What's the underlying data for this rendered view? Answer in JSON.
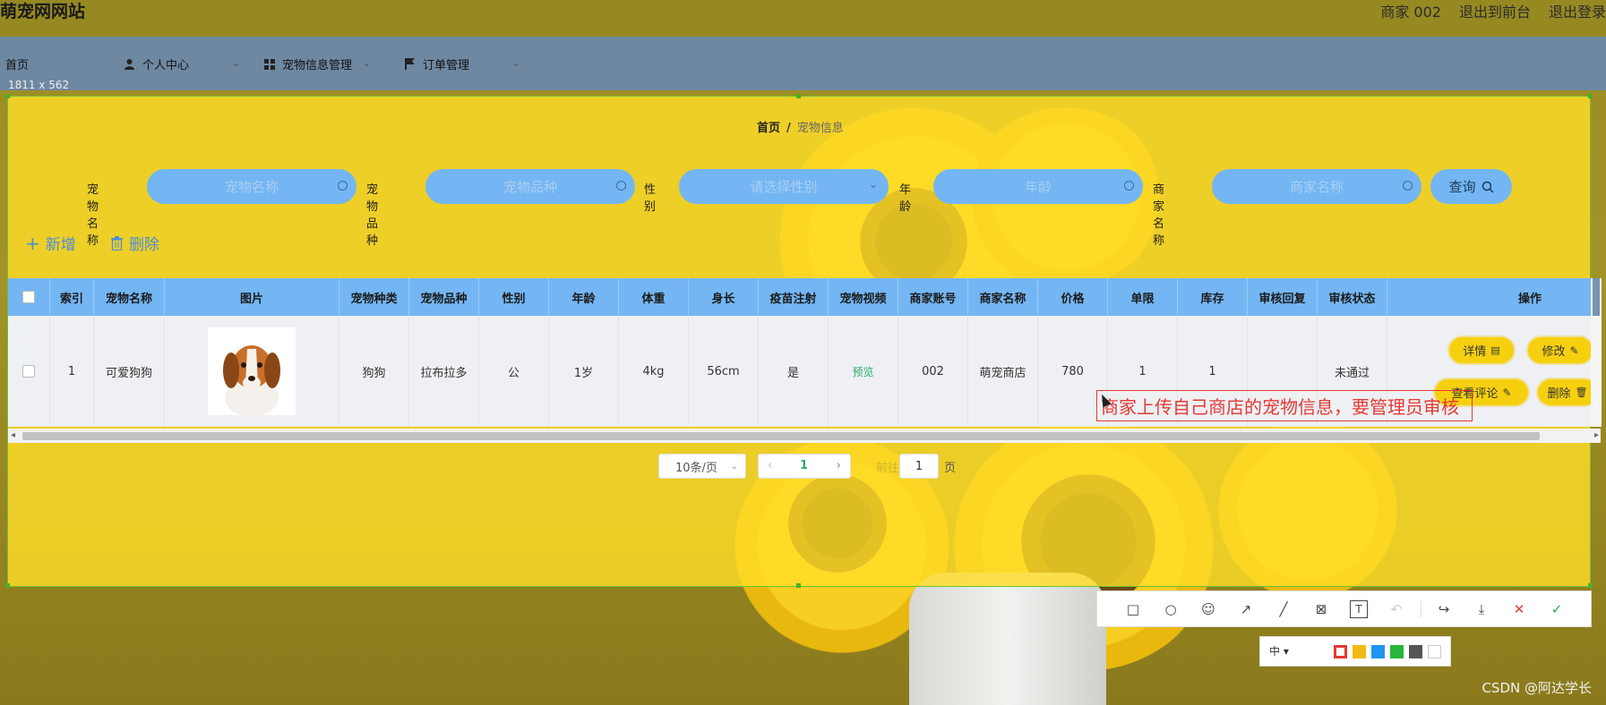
{
  "header": {
    "site_title": "萌宠网网站",
    "merchant": "商家 002",
    "exit_front": "退出到前台",
    "logout": "退出登录"
  },
  "nav": {
    "home": "首页",
    "personal_center": "个人中心",
    "pet_info_mgmt": "宠物信息管理",
    "order_mgmt": "订单管理"
  },
  "size_tag": "1811 x 562",
  "breadcrumb": {
    "home": "首页",
    "sep": "/",
    "current": "宠物信息"
  },
  "search": {
    "pet_name_label": "宠物名称",
    "pet_name_placeholder": "宠物名称",
    "breed_label": "宠物品种",
    "breed_placeholder": "宠物品种",
    "gender_label": "性别",
    "gender_placeholder": "请选择性别",
    "age_label": "年龄",
    "age_placeholder": "年龄",
    "merchant_label": "商家名称",
    "merchant_placeholder": "商家名称",
    "query_button": "查询"
  },
  "actions": {
    "add": "新增",
    "delete": "删除"
  },
  "table": {
    "headers": [
      "索引",
      "宠物名称",
      "图片",
      "宠物种类",
      "宠物品种",
      "性别",
      "年龄",
      "体重",
      "身长",
      "疫苗注射",
      "宠物视频",
      "商家账号",
      "商家名称",
      "价格",
      "单限",
      "库存",
      "审核回复",
      "审核状态",
      "操作"
    ],
    "row": {
      "index": "1",
      "pet_name": "可爱狗狗",
      "pet_type": "狗狗",
      "breed": "拉布拉多",
      "gender": "公",
      "age": "1岁",
      "weight": "4kg",
      "length": "56cm",
      "vaccinated": "是",
      "video": "预览",
      "merchant_account": "002",
      "merchant_name": "萌宠商店",
      "price": "780",
      "limit": "1",
      "stock": "1",
      "review_reply": "",
      "review_status": "未通过"
    },
    "ops": {
      "detail": "详情",
      "edit": "修改",
      "comments": "查看评论",
      "delete": "删除"
    }
  },
  "annotation": "商家上传自己商店的宠物信息，要管理员审核",
  "pagination": {
    "page_size": "10条/页",
    "current_page": "1",
    "goto_prefix": "前往",
    "goto_value": "1",
    "goto_suffix": "页"
  },
  "screenshot_tool": {
    "size_label": "中"
  },
  "colors": {
    "header_bg": "#978922",
    "nav_bg": "#6f88a2",
    "panel_yellow": "#ffdd28",
    "input_blue": "#74b6f3",
    "op_button": "#f6d00f",
    "annotation_red": "#e53935",
    "swatches": [
      "#e53935",
      "#f5b914",
      "#2196f3",
      "#27b53b",
      "#555555",
      "#ffffff"
    ]
  },
  "watermark": "CSDN @阿达学长"
}
